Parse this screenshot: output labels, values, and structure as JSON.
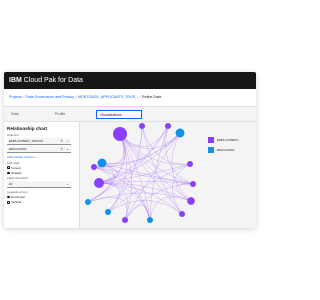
{
  "app": {
    "brand": "IBM",
    "product": "Cloud Pak for Data"
  },
  "breadcrumbs": [
    {
      "label": "Projects",
      "link": true
    },
    {
      "label": "Data Governance and Privacy",
      "link": true
    },
    {
      "label": "MORTGAGE_APPLICANTS_TRUS...",
      "link": true
    },
    {
      "label": "Refine Data",
      "link": false
    }
  ],
  "breadcrumb_separator": "/",
  "tabs": [
    {
      "label": "Data",
      "active": false
    },
    {
      "label": "Profile",
      "active": false
    },
    {
      "label": "Visualizations",
      "active": true
    }
  ],
  "panel": {
    "title": "Relationship chart",
    "columns_label": "Columns",
    "columns": [
      "EMPLOYMENT_STATUS",
      "EDUCATION"
    ],
    "add_column": "Add another column +",
    "line_style_label": "Line style",
    "line_styles": [
      {
        "label": "Curved",
        "selected": true
      },
      {
        "label": "Straight",
        "selected": false
      }
    ],
    "label_threshold_label": "Label threshold",
    "label_threshold_value": "20",
    "legends_label": "Legends at text",
    "legends_options": [
      {
        "label": "Horizontal",
        "selected": false
      },
      {
        "label": "Vertical",
        "selected": true
      }
    ]
  },
  "legend": [
    {
      "label": "EMPLOYMENT...",
      "color": "#8a3ffc"
    },
    {
      "label": "EDUCATION",
      "color": "#1192e8"
    }
  ],
  "colors": {
    "primary": "#0f62fe",
    "purple": "#8a3ffc",
    "cyan": "#1192e8",
    "edge": "#a56eff"
  },
  "icons": {
    "dropdown": "chevron-down-icon",
    "clear": "close-icon"
  },
  "chart_data": {
    "type": "relationship",
    "nodes": [
      {
        "id": "e1",
        "group": "EMPLOYMENT...",
        "weight": 9
      },
      {
        "id": "c1",
        "group": "EDUCATION",
        "weight": 3
      },
      {
        "id": "c2",
        "group": "EDUCATION",
        "weight": 3
      },
      {
        "id": "e2",
        "group": "EMPLOYMENT...",
        "weight": 1
      },
      {
        "id": "e3",
        "group": "EMPLOYMENT...",
        "weight": 1
      },
      {
        "id": "e4",
        "group": "EMPLOYMENT...",
        "weight": 2
      },
      {
        "id": "e5",
        "group": "EMPLOYMENT...",
        "weight": 1
      },
      {
        "id": "c3",
        "group": "EDUCATION",
        "weight": 1
      },
      {
        "id": "e6",
        "group": "EMPLOYMENT...",
        "weight": 1
      },
      {
        "id": "c4",
        "group": "EDUCATION",
        "weight": 1
      },
      {
        "id": "e7",
        "group": "EMPLOYMENT...",
        "weight": 4
      },
      {
        "id": "e8",
        "group": "EMPLOYMENT...",
        "weight": 1
      },
      {
        "id": "e9",
        "group": "EMPLOYMENT...",
        "weight": 1
      },
      {
        "id": "c5",
        "group": "EDUCATION",
        "weight": 1
      },
      {
        "id": "e10",
        "group": "EMPLOYMENT...",
        "weight": 1
      }
    ]
  }
}
